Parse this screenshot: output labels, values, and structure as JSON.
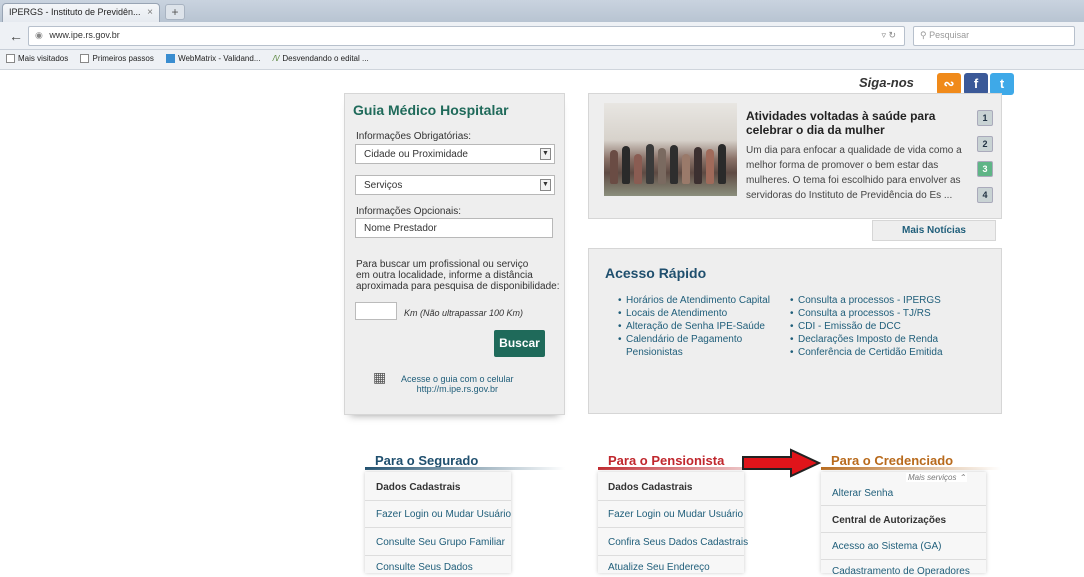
{
  "browser": {
    "tab_title": "IPERGS - Instituto de Previdên...",
    "tab_close": "×",
    "new_tab": "+",
    "url": "www.ipe.rs.gov.br",
    "search_placeholder": "Pesquisar",
    "bookmarks": [
      "Mais visitados",
      "Primeiros passos",
      "WebMatrix - Validand...",
      "Desvendando o edital ..."
    ]
  },
  "social": {
    "label": "Siga-nos",
    "icons": [
      "rss-icon",
      "facebook-icon",
      "twitter-icon"
    ],
    "fb_glyph": "f",
    "tw_glyph": "t"
  },
  "guia": {
    "title": "Guia Médico Hospitalar",
    "obrig_label": "Informações Obrigatórias:",
    "cidade": "Cidade ou Proximidade",
    "servicos": "Serviços",
    "opc_label": "Informações Opcionais:",
    "nome_placeholder": "Nome Prestador",
    "help_text_1": "Para buscar um profissional ou serviço",
    "help_text_2": "em outra localidade, informe a distância",
    "help_text_3": "aproximada para pesquisa de disponibilidade:",
    "km_label": "Km (Não ultrapassar 100 Km)",
    "buscar": "Buscar",
    "mobile_1": "Acesse o guia com o celular",
    "mobile_2": "http://m.ipe.rs.gov.br"
  },
  "news": {
    "title": "Atividades voltadas à saúde para celebrar o dia da mulher",
    "body": "Um dia para enfocar a qualidade de vida como a melhor forma de promover o bem estar das mulheres. O tema foi escolhido para envolver as servidoras do Instituto de Previdência do Es ...",
    "pages": [
      "1",
      "2",
      "3",
      "4"
    ],
    "active_page": 3,
    "more": "Mais Notícias"
  },
  "acesso": {
    "title": "Acesso Rápido",
    "left": [
      "Horários de Atendimento Capital",
      "Locais de Atendimento",
      "Alteração de Senha IPE-Saúde",
      "Calendário de Pagamento Pensionistas"
    ],
    "right": [
      "Consulta a processos - IPERGS",
      "Consulta a processos - TJ/RS",
      "CDI - Emissão de DCC",
      "Declarações Imposto de Renda",
      "Conferência de Certidão Emitida"
    ]
  },
  "segurado": {
    "title": "Para o Segurado",
    "items": [
      "Dados Cadastrais",
      "Fazer Login ou Mudar Usuário",
      "Consulte Seu Grupo Familiar",
      "Consulte Seus Dados"
    ]
  },
  "pensionista": {
    "title": "Para o Pensionista",
    "items": [
      "Dados Cadastrais",
      "Fazer Login ou Mudar Usuário",
      "Confira Seus Dados Cadastrais",
      "Atualize Seu Endereço"
    ]
  },
  "credenciado": {
    "title": "Para o Credenciado",
    "mais_servicos": "Mais serviços",
    "items": [
      "Alterar Senha",
      "Central de Autorizações",
      "Acesso ao Sistema (GA)",
      "Cadastramento de Operadores"
    ]
  },
  "colors": {
    "green": "#1f6a5a",
    "segurado": "#1f4f6e",
    "pensionista": "#c0272d",
    "credenciado": "#b86a1c",
    "arrow": "#e0141a"
  }
}
